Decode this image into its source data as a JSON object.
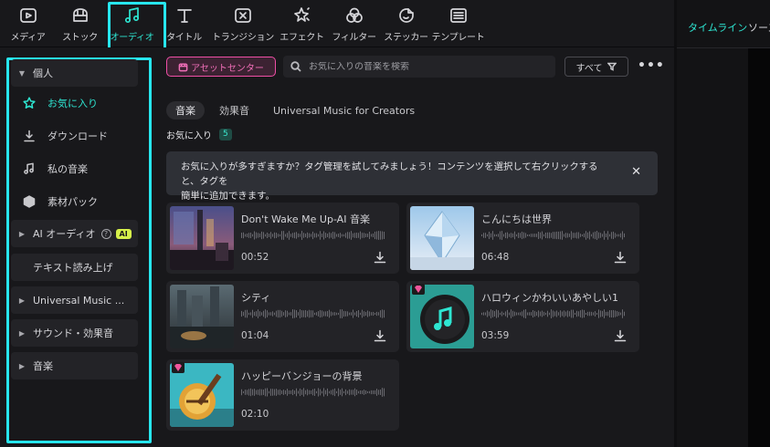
{
  "toolbar": {
    "items": [
      {
        "label": "メディア",
        "icon": "media-icon"
      },
      {
        "label": "ストック",
        "icon": "stock-icon"
      },
      {
        "label": "オーディオ",
        "icon": "music-note-icon"
      },
      {
        "label": "タイトル",
        "icon": "title-t-icon"
      },
      {
        "label": "トランジション",
        "icon": "transition-icon"
      },
      {
        "label": "エフェクト",
        "icon": "effects-star-icon"
      },
      {
        "label": "フィルター",
        "icon": "filter-icon"
      },
      {
        "label": "ステッカー",
        "icon": "sticker-icon"
      },
      {
        "label": "テンプレート",
        "icon": "template-icon"
      }
    ],
    "active_index": 2
  },
  "right_panel": {
    "tab_timeline": "タイムライン",
    "tab_source": "ソース"
  },
  "sidebar": {
    "personal": "個人",
    "sub_items": [
      {
        "label": "お気に入り",
        "icon": "star-icon"
      },
      {
        "label": "ダウンロード",
        "icon": "download-icon"
      },
      {
        "label": "私の音楽",
        "icon": "music-note-icon"
      },
      {
        "label": "素材パック",
        "icon": "package-icon"
      }
    ],
    "ai_audio": "AI オーディオ",
    "ai_badge": "AI",
    "tts": "テキスト読み上げ",
    "universal": "Universal Music ...",
    "sound_effects": "サウンド・効果音",
    "music": "音楽"
  },
  "main": {
    "asset_center": "アセットセンター",
    "search_placeholder": "お気に入りの音楽を検索",
    "filter": "すべて",
    "more": "•••",
    "categories": [
      "音楽",
      "効果音",
      "Universal Music for Creators"
    ],
    "favorites_label": "お気に入り",
    "favorites_count": "5",
    "notice_line1": "お気に入りが多すぎますか？タグ管理を試してみましょう！コンテンツを選択して右クリックすると、タグを",
    "notice_line2": "簡単に追加できます。",
    "notice_close": "✕",
    "tracks": [
      {
        "title": "Don't Wake Me Up-AI 音楽",
        "duration": "00:52",
        "premium": false
      },
      {
        "title": "こんにちは世界",
        "duration": "06:48",
        "premium": false
      },
      {
        "title": "シティ",
        "duration": "01:04",
        "premium": false
      },
      {
        "title": "ハロウィンかわいいあやしい1",
        "duration": "03:59",
        "premium": true
      },
      {
        "title": "ハッピーバンジョーの背景",
        "duration": "02:10",
        "premium": true
      }
    ]
  },
  "colors": {
    "accent": "#2ee6d2",
    "highlight_frame": "#27e6ee",
    "asset_pink": "#ef4fa6",
    "ai_badge": "#d6f04a"
  }
}
